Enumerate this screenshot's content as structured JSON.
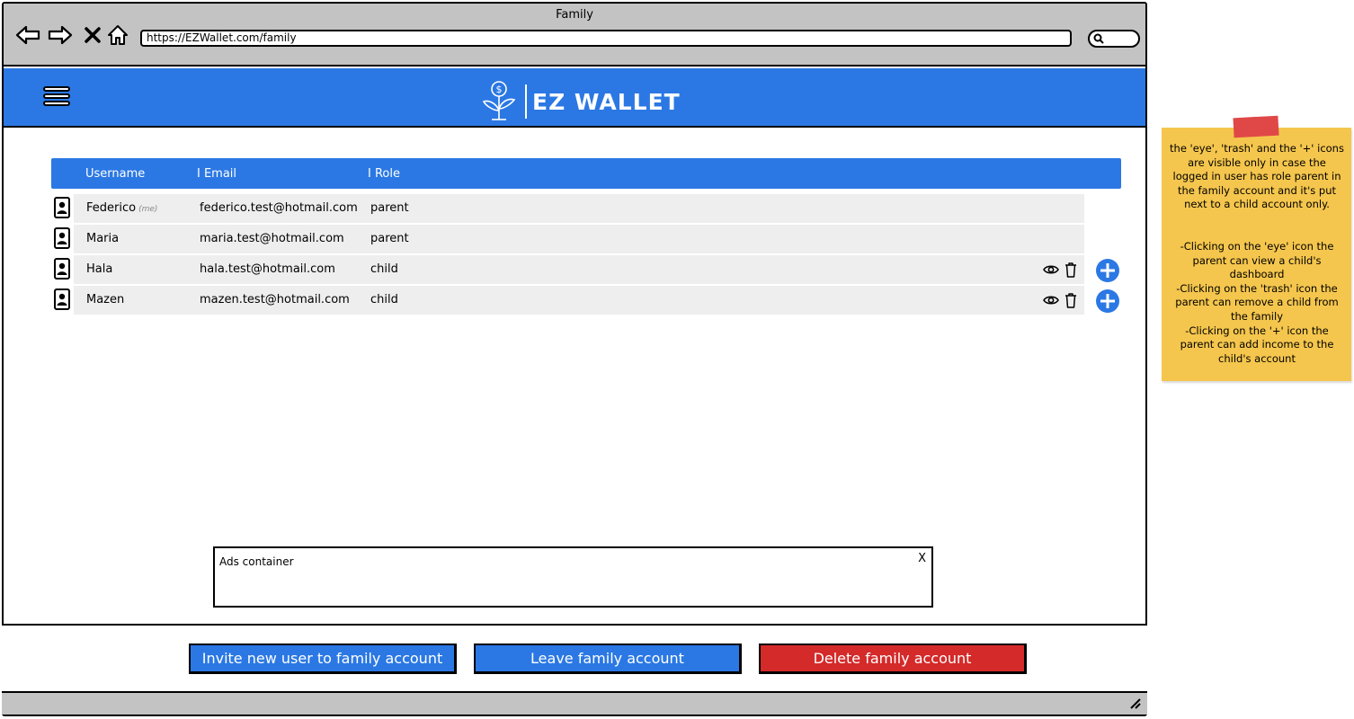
{
  "browser": {
    "window_title": "Family",
    "url": "https://EZWallet.com/family",
    "nav_icons": [
      "back-arrow-icon",
      "forward-arrow-icon",
      "close-x-icon",
      "home-icon"
    ],
    "search_icon": "magnifier-icon"
  },
  "header": {
    "menu_icon": "hamburger-menu-icon",
    "logo_icon": "money-plant-icon",
    "logo_text": "EZ WALLET",
    "background": "#2b78e4"
  },
  "table": {
    "columns": [
      "Username",
      "I Email",
      "I Role"
    ],
    "rows": [
      {
        "username": "Federico",
        "tag": "(me)",
        "email": "federico.test@hotmail.com",
        "role": "parent",
        "actions": false
      },
      {
        "username": "Maria",
        "tag": "",
        "email": "maria.test@hotmail.com",
        "role": "parent",
        "actions": false
      },
      {
        "username": "Hala",
        "tag": "",
        "email": "hala.test@hotmail.com",
        "role": "child",
        "actions": true
      },
      {
        "username": "Mazen",
        "tag": "",
        "email": "mazen.test@hotmail.com",
        "role": "child",
        "actions": true
      }
    ]
  },
  "ads": {
    "label": "Ads container",
    "close": "X"
  },
  "footer": {
    "invite_label": "Invite new user to family account",
    "leave_label": "Leave family account",
    "delete_label": "Delete family account",
    "primary_color": "#2b78e4",
    "danger_color": "#d42a2a"
  },
  "note": {
    "p1": "the 'eye', 'trash' and the '+' icons are visible only in case the logged in user has role parent in the family account and it's put next to a child account only.",
    "p2": "-Clicking on the 'eye' icon the parent can view a child's dashboard",
    "p3": "-Clicking on the 'trash' icon the parent can remove a child from the family",
    "p4": "-Clicking on the '+' icon the parent can add income to the child's account",
    "color": "#f5c64d"
  }
}
